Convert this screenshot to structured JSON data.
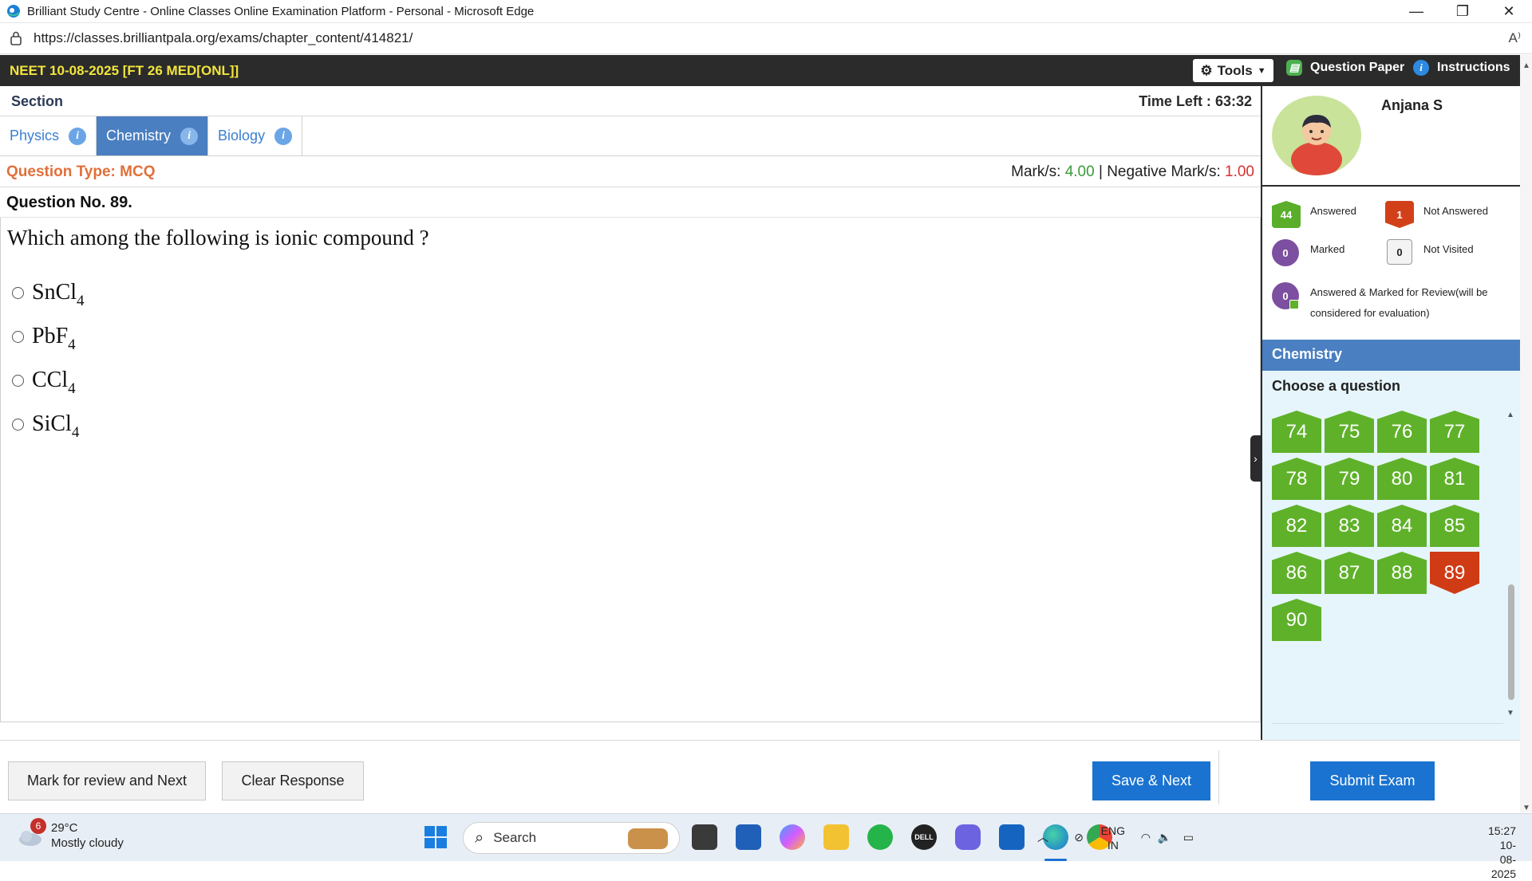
{
  "browser": {
    "window_title": "Brilliant Study Centre - Online Classes Online Examination Platform - Personal - Microsoft Edge",
    "url": "https://classes.brilliantpala.org/exams/chapter_content/414821/",
    "minimize": "—",
    "restore": "❐",
    "close": "✕",
    "read_aloud": "A⁾"
  },
  "exam": {
    "title": "NEET 10-08-2025 [FT 26 MED[ONL]]",
    "tools_label": "Tools",
    "question_paper_label": "Question Paper",
    "instructions_label": "Instructions",
    "section_label": "Section",
    "time_left_label": "Time Left :",
    "time_left_value": "63:32",
    "tabs": [
      {
        "label": "Physics",
        "active": false
      },
      {
        "label": "Chemistry",
        "active": true
      },
      {
        "label": "Biology",
        "active": false
      }
    ],
    "info_glyph": "i"
  },
  "question": {
    "type_label": "Question Type: MCQ",
    "marks_label": "Mark/s:",
    "marks_value": "4.00",
    "separator": "|",
    "negative_label": "Negative Mark/s:",
    "negative_value": "1.00",
    "number_label": "Question No. 89.",
    "text": "Which among the following is ionic compound ?",
    "options": [
      {
        "main": "SnCl",
        "sub": "4"
      },
      {
        "main": "PbF",
        "sub": "4"
      },
      {
        "main": "CCl",
        "sub": "4"
      },
      {
        "main": "SiCl",
        "sub": "4"
      }
    ]
  },
  "panel": {
    "username": "Anjana S",
    "legend": {
      "answered_count": "44",
      "answered_label": "Answered",
      "not_answered_count": "1",
      "not_answered_label": "Not Answered",
      "marked_count": "0",
      "marked_label": "Marked",
      "not_visited_count": "0",
      "not_visited_label": "Not Visited",
      "ans_marked_count": "0",
      "ans_marked_label": "Answered & Marked for Review(will be considered for evaluation)"
    },
    "subject_heading": "Chemistry",
    "choose_label": "Choose a question",
    "questions": [
      {
        "n": "74",
        "status": "answered"
      },
      {
        "n": "75",
        "status": "answered"
      },
      {
        "n": "76",
        "status": "answered"
      },
      {
        "n": "77",
        "status": "answered"
      },
      {
        "n": "78",
        "status": "answered"
      },
      {
        "n": "79",
        "status": "answered"
      },
      {
        "n": "80",
        "status": "answered"
      },
      {
        "n": "81",
        "status": "answered"
      },
      {
        "n": "82",
        "status": "answered"
      },
      {
        "n": "83",
        "status": "answered"
      },
      {
        "n": "84",
        "status": "answered"
      },
      {
        "n": "85",
        "status": "answered"
      },
      {
        "n": "86",
        "status": "answered"
      },
      {
        "n": "87",
        "status": "answered"
      },
      {
        "n": "88",
        "status": "answered"
      },
      {
        "n": "89",
        "status": "not-answered"
      },
      {
        "n": "90",
        "status": "answered"
      }
    ]
  },
  "actions": {
    "mark_review": "Mark for review and Next",
    "clear": "Clear Response",
    "save_next": "Save & Next",
    "submit": "Submit Exam"
  },
  "taskbar": {
    "weather_badge": "6",
    "temperature": "29°C",
    "weather_desc": "Mostly cloudy",
    "search_placeholder": "Search",
    "lang_top": "ENG",
    "lang_bottom": "IN",
    "time": "15:27",
    "date": "10-08-2025",
    "dell_label": "DELL"
  },
  "colors": {
    "header_bg": "#2b2b2b",
    "exam_title": "#f2e43d",
    "tab_active": "#4a7fc1",
    "answered": "#5fb12a",
    "not_answered": "#cf3b15",
    "button_blue": "#1a73d0"
  }
}
